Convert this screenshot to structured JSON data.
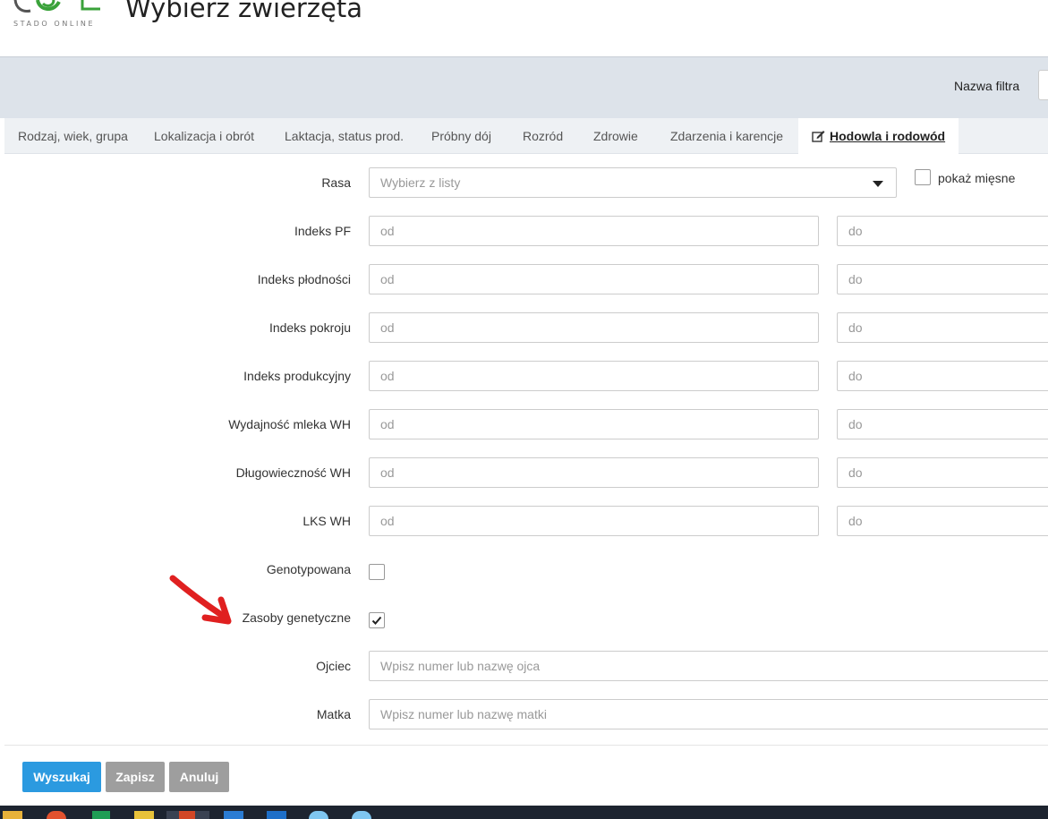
{
  "app": {
    "logo_text": "STADO ONLINE",
    "page_title": "Wybierz zwierzęta"
  },
  "filterbar": {
    "label": "Nazwa filtra"
  },
  "tabs": [
    {
      "label": "Rodzaj, wiek, grupa"
    },
    {
      "label": "Lokalizacja i obrót"
    },
    {
      "label": "Laktacja, status prod."
    },
    {
      "label": "Próbny dój"
    },
    {
      "label": "Rozród"
    },
    {
      "label": "Zdrowie"
    },
    {
      "label": "Zdarzenia i karencje"
    },
    {
      "label": "Hodowla i rodowód",
      "active": true,
      "icon": "edit-icon"
    }
  ],
  "form": {
    "rasa": {
      "label": "Rasa",
      "placeholder": "Wybierz z listy"
    },
    "pokaz_miesne": {
      "label": "pokaż mięsne",
      "checked": false
    },
    "ranges": [
      {
        "label": "Indeks PF",
        "from": "od",
        "to": "do"
      },
      {
        "label": "Indeks płodności",
        "from": "od",
        "to": "do"
      },
      {
        "label": "Indeks pokroju",
        "from": "od",
        "to": "do"
      },
      {
        "label": "Indeks produkcyjny",
        "from": "od",
        "to": "do"
      },
      {
        "label": "Wydajność mleka WH",
        "from": "od",
        "to": "do"
      },
      {
        "label": "Długowieczność WH",
        "from": "od",
        "to": "do"
      },
      {
        "label": "LKS WH",
        "from": "od",
        "to": "do"
      }
    ],
    "genotypowana": {
      "label": "Genotypowana",
      "checked": false
    },
    "zasoby": {
      "label": "Zasoby genetyczne",
      "checked": true
    },
    "ojciec": {
      "label": "Ojciec",
      "placeholder": "Wpisz numer lub nazwę ojca"
    },
    "matka": {
      "label": "Matka",
      "placeholder": "Wpisz numer lub nazwę matki"
    }
  },
  "buttons": {
    "search": "Wyszukaj",
    "save": "Zapisz",
    "cancel": "Anuluj"
  },
  "colors": {
    "primary": "#2b9ae0",
    "gray_button": "#9e9e9e",
    "annotation_arrow": "#e02020",
    "logo_green": "#3aa23a"
  }
}
